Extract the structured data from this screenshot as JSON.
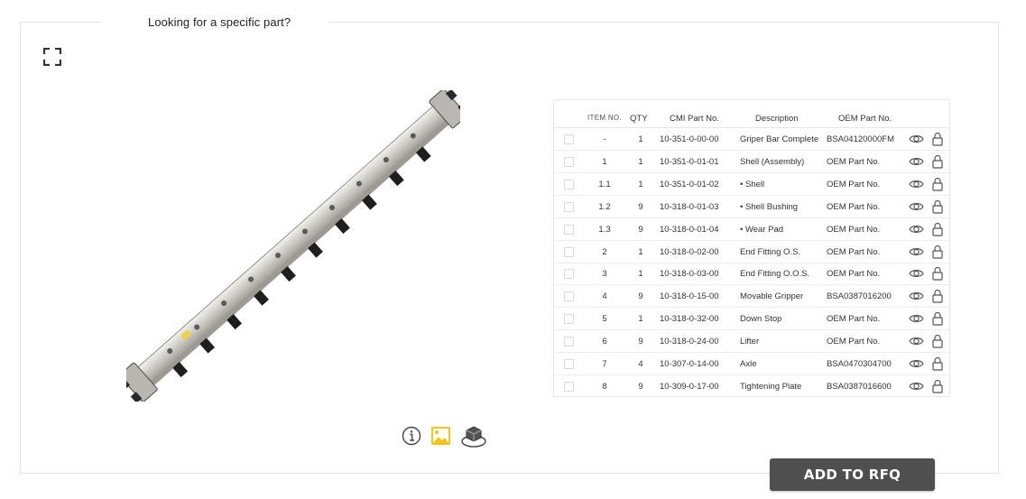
{
  "header": {
    "title": "Looking for a specific part?"
  },
  "table": {
    "columns": [
      "ITEM NO.",
      "QTY",
      "CMI Part No.",
      "Description",
      "OEM Part No."
    ],
    "rows": [
      {
        "item": "-",
        "qty": "1",
        "cmi": "10-351-0-00-00",
        "desc": "Griper Bar Complete",
        "oem": "BSA04120000FM"
      },
      {
        "item": "1",
        "qty": "1",
        "cmi": "10-351-0-01-01",
        "desc": "Shell (Assembly)",
        "oem": "OEM Part No."
      },
      {
        "item": "1.1",
        "qty": "1",
        "cmi": "10-351-0-01-02",
        "desc": "• Shell",
        "oem": "OEM Part No."
      },
      {
        "item": "1.2",
        "qty": "9",
        "cmi": "10-318-0-01-03",
        "desc": "• Shell Bushing",
        "oem": "OEM Part No."
      },
      {
        "item": "1.3",
        "qty": "9",
        "cmi": "10-318-0-01-04",
        "desc": "• Wear Pad",
        "oem": "OEM Part No."
      },
      {
        "item": "2",
        "qty": "1",
        "cmi": "10-318-0-02-00",
        "desc": "End Fitting O.S.",
        "oem": "OEM Part No."
      },
      {
        "item": "3",
        "qty": "1",
        "cmi": "10-318-0-03-00",
        "desc": "End Fitting O.O.S.",
        "oem": "OEM Part No."
      },
      {
        "item": "4",
        "qty": "9",
        "cmi": "10-318-0-15-00",
        "desc": "Movable Gripper",
        "oem": "BSA0387016200"
      },
      {
        "item": "5",
        "qty": "1",
        "cmi": "10-318-0-32-00",
        "desc": "Down Stop",
        "oem": "OEM Part No."
      },
      {
        "item": "6",
        "qty": "9",
        "cmi": "10-318-0-24-00",
        "desc": "Lifter",
        "oem": "OEM Part No."
      },
      {
        "item": "7",
        "qty": "4",
        "cmi": "10-307-0-14-00",
        "desc": "Axle",
        "oem": "BSA0470304700"
      },
      {
        "item": "8",
        "qty": "9",
        "cmi": "10-309-0-17-00",
        "desc": "Tightening Plate",
        "oem": "BSA0387016600"
      }
    ]
  },
  "viewer": {
    "icons": [
      "info-icon",
      "image-icon",
      "3d-model-icon",
      "expand-icon"
    ]
  },
  "actions": {
    "rfq_label": "ADD TO RFQ"
  },
  "colors": {
    "accent_yellow": "#f5c518",
    "button": "#4f4f4f",
    "border": "#e6e6e6"
  }
}
